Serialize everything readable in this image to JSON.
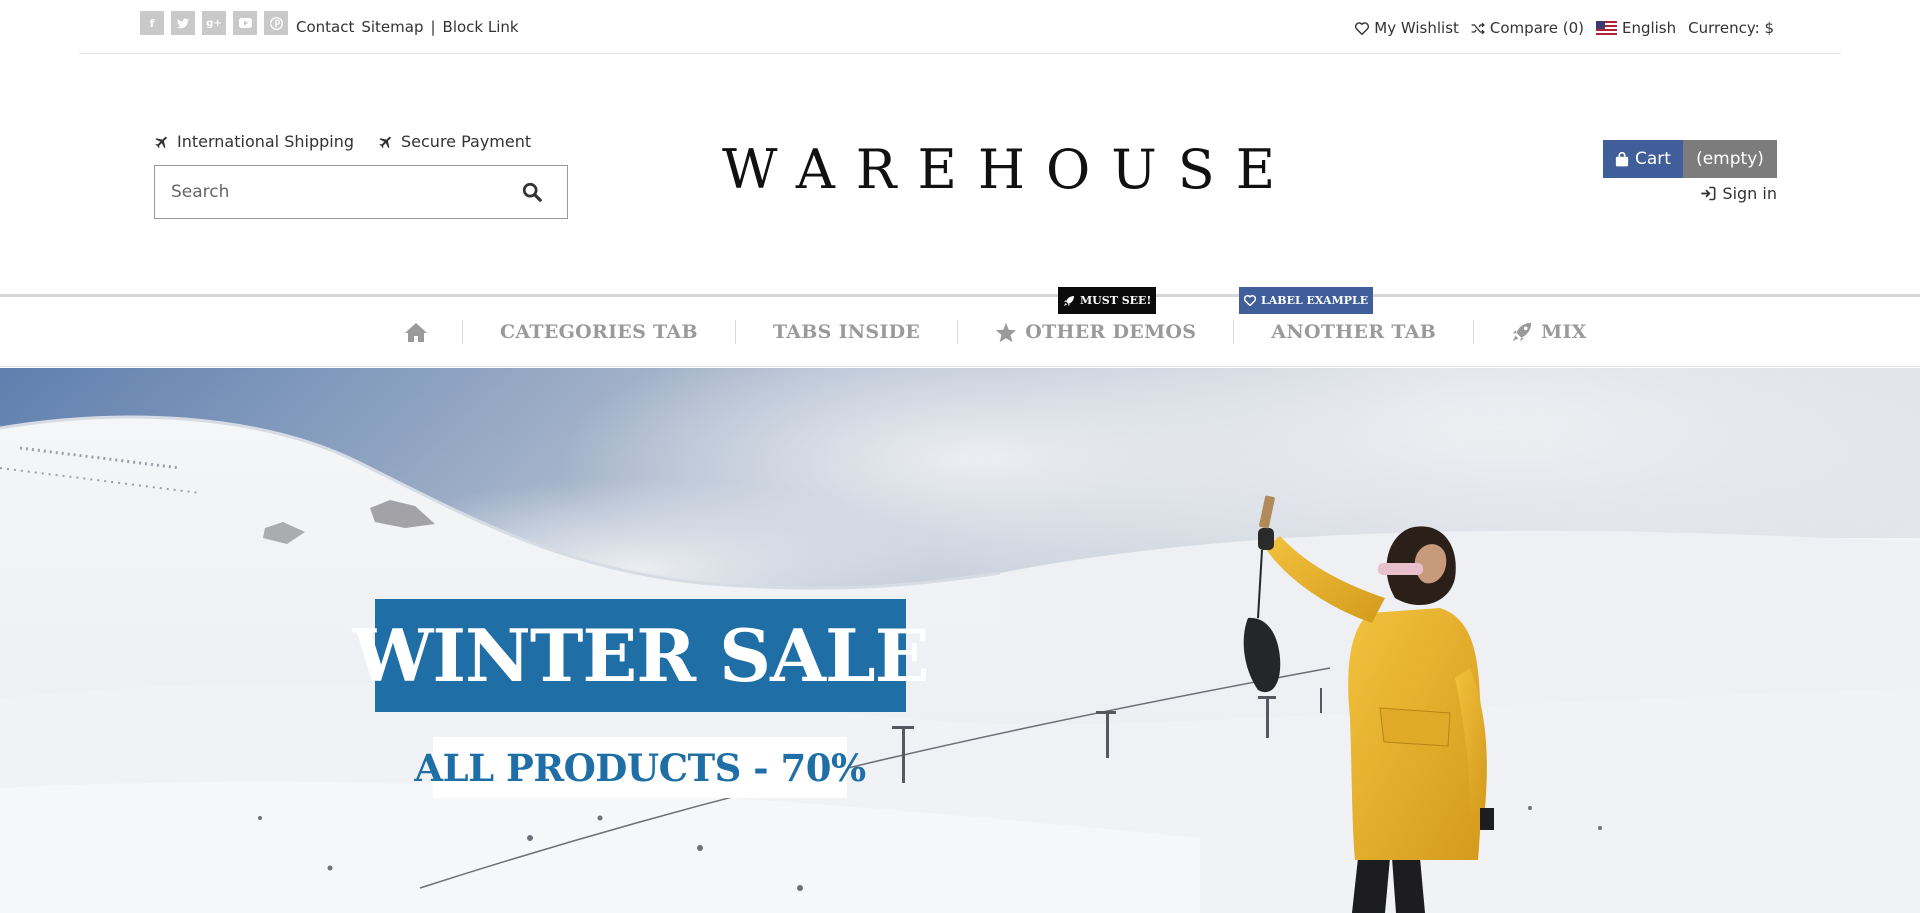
{
  "topbar": {
    "social": [
      {
        "icon": "facebook-icon",
        "glyph": "f"
      },
      {
        "icon": "twitter-icon",
        "glyph": "t"
      },
      {
        "icon": "google-plus-icon",
        "glyph": "g+"
      },
      {
        "icon": "youtube-icon",
        "glyph": "▶"
      },
      {
        "icon": "pinterest-icon",
        "glyph": "p"
      }
    ],
    "contact": "Contact",
    "sitemap": "Sitemap",
    "separator": "|",
    "block_link": "Block Link",
    "wishlist": "My Wishlist",
    "compare": "Compare (0)",
    "language": "English",
    "currency": "Currency: $"
  },
  "header": {
    "shipping": "International Shipping",
    "payment": "Secure Payment",
    "search_placeholder": "Search",
    "logo": "WAREHOUSE",
    "cart_label": "Cart",
    "cart_status": "(empty)",
    "sign_in": "Sign in"
  },
  "menu": {
    "items": [
      {
        "label": "CATEGORIES TAB"
      },
      {
        "label": "TABS INSIDE"
      },
      {
        "label": "OTHER DEMOS",
        "icon": "star-icon",
        "badge": "MUST SEE!"
      },
      {
        "label": "ANOTHER TAB",
        "badge": "LABEL EXAMPLE"
      },
      {
        "label": "MIX",
        "icon": "rocket-icon"
      }
    ]
  },
  "hero": {
    "title": "WINTER SALE",
    "subtitle": "ALL PRODUCTS - 70%"
  },
  "colors": {
    "accent_blue": "#1f6fa6",
    "cart_blue": "#3f5e9a",
    "cart_gray": "#7c7c7c",
    "jacket_yellow": "#e8b22c"
  }
}
